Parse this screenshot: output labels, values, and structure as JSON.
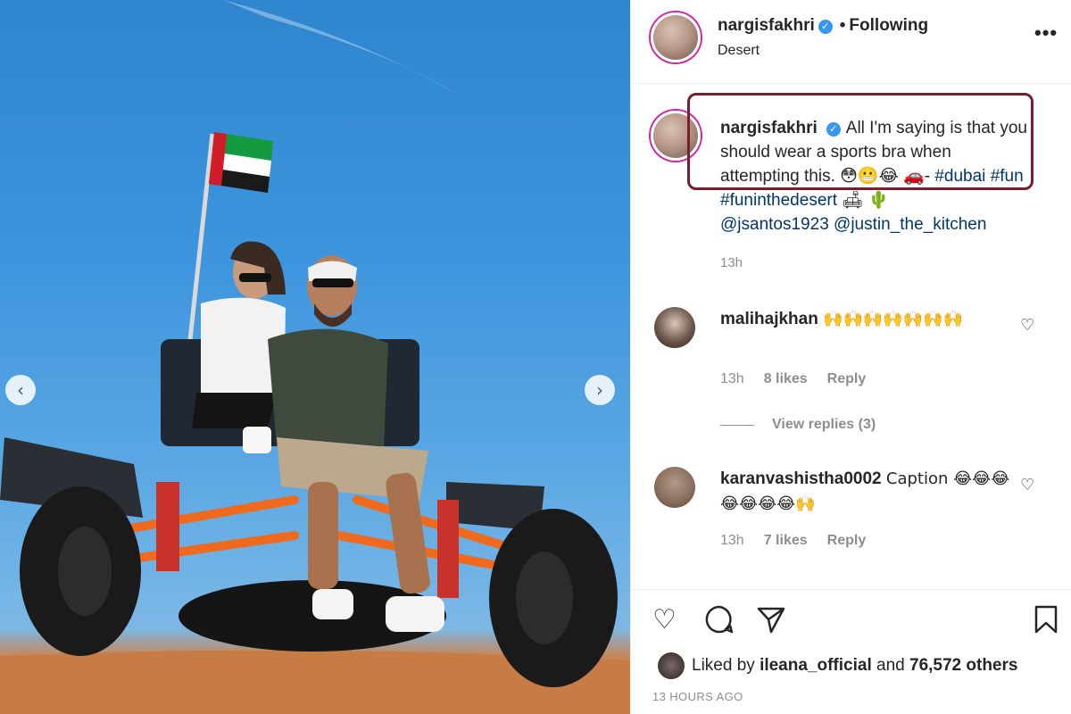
{
  "post": {
    "username": "nargisfakhri",
    "verified_mark": "✓",
    "dot": "•",
    "follow_status": "Following",
    "location": "Desert",
    "more_icon": "•••"
  },
  "photo": {
    "prev_arrow": "‹",
    "next_arrow": "›"
  },
  "caption": {
    "username": "nargisfakhri",
    "text": "All I'm saying is that you should wear a sports bra when attempting this. 😳😬😂 🚗- ",
    "tag_dubai": "#dubai",
    "tag_fun": "#fun",
    "tag_funinthedesert": "#funinthedesert",
    "emoji_tail": " 🛋 🌵",
    "mention_1": "@jsantos1923",
    "mention_2": "@justin_the_kitchen",
    "time": "13h"
  },
  "comments": [
    {
      "username": "malihajkhan",
      "text": "🙌🙌🙌🙌🙌🙌🙌",
      "time": "13h",
      "likes": "8 likes",
      "reply": "Reply"
    },
    {
      "username": "karanvashistha0002",
      "text": "Caption 😂😂😂😂😂😂😂🙌",
      "time": "13h",
      "likes": "7 likes",
      "reply": "Reply"
    }
  ],
  "view_replies": "View replies (3)",
  "actions": {
    "like_icon": "♡",
    "comment_icon": "💬",
    "share_icon": "➤",
    "save_icon": "🔖"
  },
  "likes": {
    "prefix": "Liked by ",
    "user": "ileana_official",
    "middle": " and ",
    "count": "76,572 others"
  },
  "posted_ago": "13 HOURS AGO",
  "colors": {
    "highlight_border": "#7b1e2c",
    "link": "#00376b",
    "muted": "#8e8e8e",
    "verified": "#3897f0"
  }
}
